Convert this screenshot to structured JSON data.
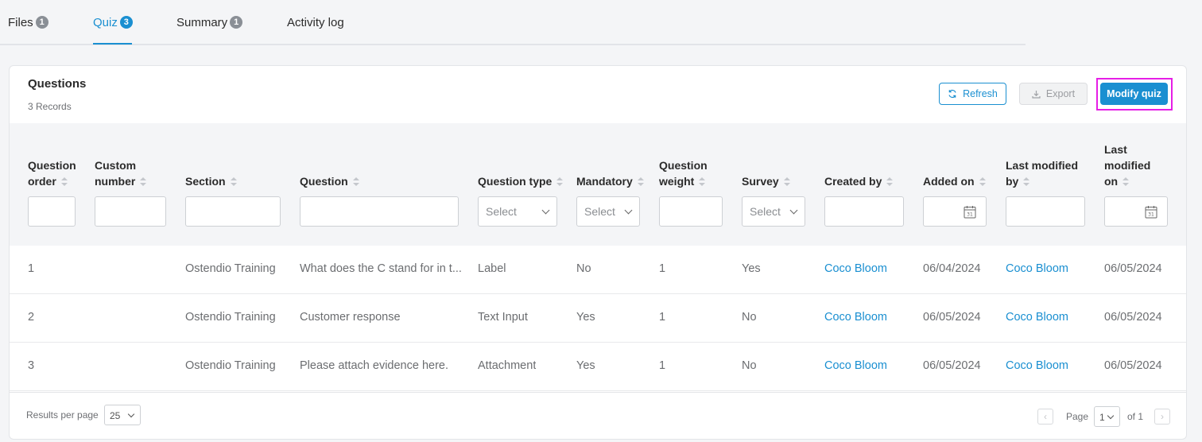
{
  "tabs": [
    {
      "label": "Files",
      "badge": "1"
    },
    {
      "label": "Quiz",
      "badge": "3"
    },
    {
      "label": "Summary",
      "badge": "1"
    },
    {
      "label": "Activity log",
      "badge": ""
    }
  ],
  "card": {
    "title": "Questions",
    "records": "3 Records",
    "refresh_label": "Refresh",
    "export_label": "Export",
    "modify_label": "Modify quiz"
  },
  "columns": [
    {
      "line1": "Question",
      "line2": "order"
    },
    {
      "line1": "Custom",
      "line2": "number"
    },
    {
      "line1": "",
      "line2": "Section"
    },
    {
      "line1": "",
      "line2": "Question"
    },
    {
      "line1": "",
      "line2": "Question type"
    },
    {
      "line1": "",
      "line2": "Mandatory"
    },
    {
      "line1": "Question",
      "line2": "weight"
    },
    {
      "line1": "",
      "line2": "Survey"
    },
    {
      "line1": "",
      "line2": "Created by"
    },
    {
      "line1": "",
      "line2": "Added on"
    },
    {
      "line1": "Last modified",
      "line2": "by"
    },
    {
      "line1": "Last",
      "line1b": "modified",
      "line2": "on"
    }
  ],
  "filters": {
    "select_placeholder": "Select"
  },
  "rows": [
    {
      "order": "1",
      "custom": "",
      "section": "Ostendio Training",
      "question": "What does the C stand for in t...",
      "type": "Label",
      "mandatory": "No",
      "weight": "1",
      "survey": "Yes",
      "created_by": "Coco Bloom",
      "added_on": "06/04/2024",
      "modified_by": "Coco Bloom",
      "modified_on": "06/05/2024"
    },
    {
      "order": "2",
      "custom": "",
      "section": "Ostendio Training",
      "question": "Customer response",
      "type": "Text Input",
      "mandatory": "Yes",
      "weight": "1",
      "survey": "No",
      "created_by": "Coco Bloom",
      "added_on": "06/05/2024",
      "modified_by": "Coco Bloom",
      "modified_on": "06/05/2024"
    },
    {
      "order": "3",
      "custom": "",
      "section": "Ostendio Training",
      "question": "Please attach evidence here.",
      "type": "Attachment",
      "mandatory": "Yes",
      "weight": "1",
      "survey": "No",
      "created_by": "Coco Bloom",
      "added_on": "06/05/2024",
      "modified_by": "Coco Bloom",
      "modified_on": "06/05/2024"
    }
  ],
  "footer": {
    "rpp_label": "Results per page",
    "rpp_value": "25",
    "page_label": "Page",
    "page_value": "1",
    "of_label": "of 1"
  },
  "colors": {
    "accent": "#1a8fd1",
    "highlight": "#e61ee6"
  }
}
